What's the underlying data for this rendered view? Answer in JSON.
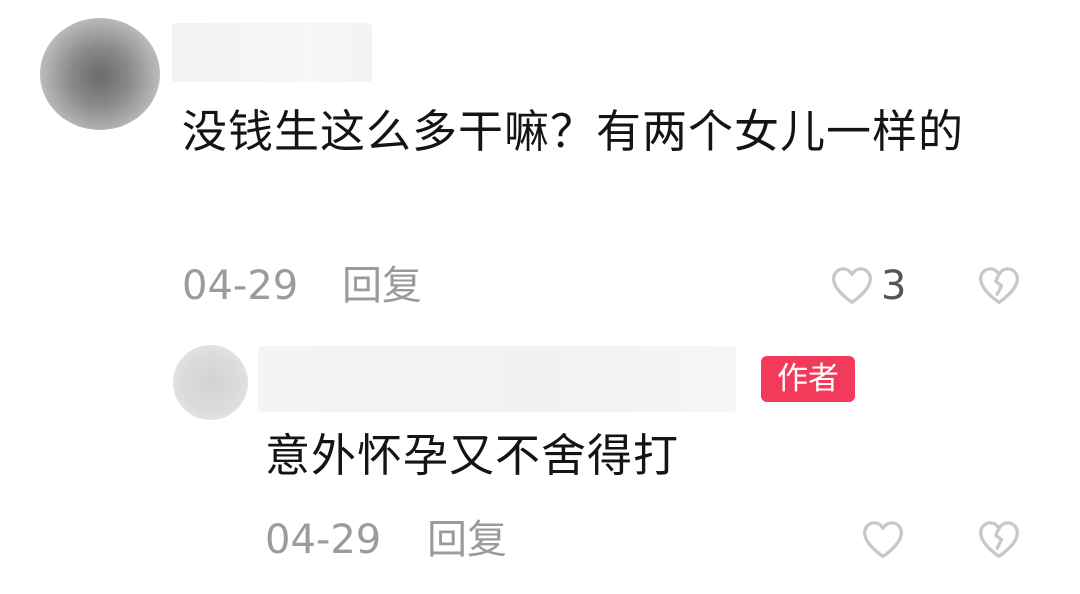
{
  "comments": [
    {
      "text": "没钱生这么多干嘛？有两个女儿一样的",
      "date": "04-29",
      "reply_label": "回复",
      "like_count": "3",
      "icons": [
        "heart-outline-icon",
        "broken-heart-icon"
      ]
    },
    {
      "badge": "作者",
      "text": "意外怀孕又不舍得打",
      "date": "04-29",
      "reply_label": "回复",
      "icons": [
        "heart-outline-icon",
        "broken-heart-icon"
      ]
    }
  ],
  "colors": {
    "badge_bg": "#f43a5a",
    "text": "#141414",
    "meta": "#9b9b9b",
    "icon": "#c8c8c8"
  }
}
